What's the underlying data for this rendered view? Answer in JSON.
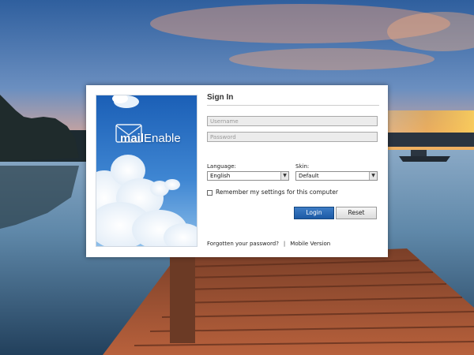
{
  "brand": {
    "logo_bold": "mail",
    "logo_regular": "Enable"
  },
  "signin": {
    "title": "Sign In",
    "username_placeholder": "Username",
    "password_placeholder": "Password",
    "language_label": "Language:",
    "language_value": "English",
    "skin_label": "Skin:",
    "skin_value": "Default",
    "remember_label": "Remember my settings for this computer",
    "remember_checked": false,
    "login_label": "Login",
    "reset_label": "Reset",
    "forgot_label": "Forgotten your password?",
    "separator": "|",
    "mobile_label": "Mobile Version"
  },
  "icons": {
    "dropdown": "chevron-down-icon",
    "logo": "envelope-icon"
  },
  "colors": {
    "login_button": "#1c5aa5",
    "sky_panel": "#1f6fc4"
  }
}
